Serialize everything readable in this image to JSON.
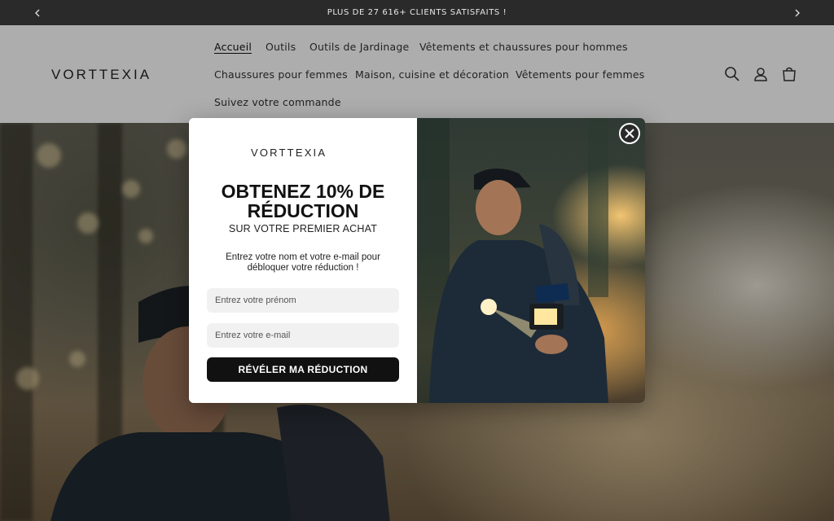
{
  "announcement": {
    "text": "PLUS DE 27 616+ CLIENTS SATISFAITS !",
    "prev_icon": "chevron-left-icon",
    "next_icon": "chevron-right-icon"
  },
  "header": {
    "logo_text": "VORTTEXIA",
    "nav": [
      {
        "label": "Accueil",
        "active": true
      },
      {
        "label": "Outils"
      },
      {
        "label": "Outils de Jardinage"
      },
      {
        "label": "Vêtements et chaussures pour hommes"
      },
      {
        "label": "Chaussures pour femmes"
      },
      {
        "label": "Maison, cuisine et décoration"
      },
      {
        "label": "Vêtements pour femmes"
      },
      {
        "label": "Suivez votre commande"
      }
    ],
    "icons": [
      "search-icon",
      "account-icon",
      "cart-icon"
    ]
  },
  "popup": {
    "logo_text": "VORTTEXIA",
    "title_line1": "OBTENEZ 10% DE",
    "title_line2": "RÉDUCTION",
    "subtitle": "SUR VOTRE PREMIER ACHAT",
    "description_line1": "Entrez votre nom et votre e-mail pour",
    "description_line2": "débloquer votre réduction !",
    "first_name_placeholder": "Entrez votre prénom",
    "email_placeholder": "Entrez votre e-mail",
    "cta_label": "RÉVÉLER MA RÉDUCTION",
    "close_icon": "close-icon"
  },
  "colors": {
    "announcement_bg": "#2a2a2a",
    "cta_bg": "#111111",
    "field_bg": "#f1f1f1"
  }
}
